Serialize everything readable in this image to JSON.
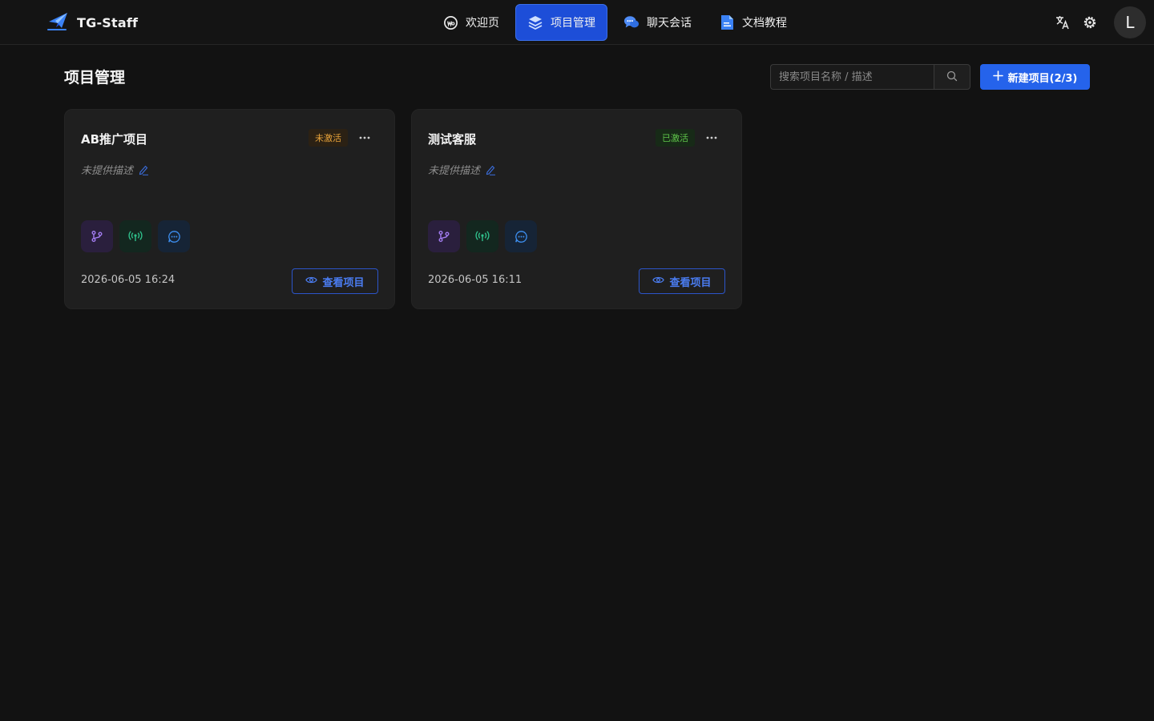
{
  "brand": {
    "name": "TG-Staff",
    "icon": "paper-plane-icon"
  },
  "nav": {
    "items": [
      {
        "label": "欢迎页",
        "icon": "welcome-icon",
        "active": false
      },
      {
        "label": "项目管理",
        "icon": "layers-icon",
        "active": true
      },
      {
        "label": "聊天会话",
        "icon": "chat-bubbles-icon",
        "active": false
      },
      {
        "label": "文档教程",
        "icon": "document-icon",
        "active": false
      }
    ]
  },
  "topRight": {
    "translateIcon": "translate-icon",
    "settingsIcon": "gear-icon",
    "avatarLetter": "L"
  },
  "page": {
    "title": "项目管理"
  },
  "search": {
    "placeholder": "搜索项目名称 / 描述",
    "value": ""
  },
  "newProject": {
    "label": "新建项目(2/3)"
  },
  "cards": [
    {
      "title": "AB推广项目",
      "status": "未激活",
      "description": "未提供描述",
      "date": "2026-06-05 16:24",
      "viewLabel": "查看项目",
      "features": [
        "workflow-icon",
        "broadcast-icon",
        "chat-icon"
      ]
    },
    {
      "title": "测试客服",
      "status": "已激活",
      "description": "未提供描述",
      "date": "2026-06-05 16:11",
      "viewLabel": "查看项目",
      "features": [
        "workflow-icon",
        "broadcast-icon",
        "chat-icon"
      ]
    }
  ],
  "colors": {
    "accent": "#2563eb",
    "inactiveBadge": "#e8a33a",
    "activeBadge": "#5fc54a",
    "background": "#121212",
    "card": "#1f1f1f"
  }
}
